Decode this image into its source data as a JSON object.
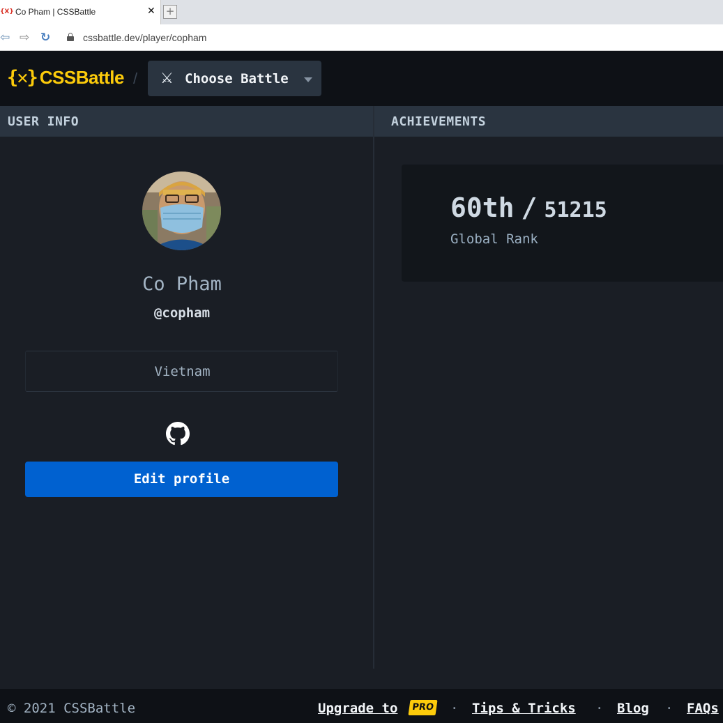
{
  "browser": {
    "tab_favicon": "{X}",
    "tab_title": "Co Pham | CSSBattle",
    "tab_close": "✕",
    "new_tab": "+",
    "nav_back": "⇦",
    "nav_forward": "⇨",
    "nav_reload": "↻",
    "url": "cssbattle.dev/player/copham"
  },
  "header": {
    "logo_mark": "{✕}",
    "logo_text": "CSSBattle",
    "separator": "/",
    "choose_battle_icon": "⚔",
    "choose_battle_label": "Choose Battle"
  },
  "user_info": {
    "section_title": "USER INFO",
    "name": "Co Pham",
    "handle": "@copham",
    "country": "Vietnam",
    "edit_button": "Edit profile"
  },
  "achievements": {
    "section_title": "ACHIEVEMENTS",
    "rank": "60th",
    "rank_separator": "/",
    "total_players": "51215",
    "rank_label": "Global Rank"
  },
  "footer": {
    "copyright": "© 2021 CSSBattle",
    "upgrade_label": "Upgrade to",
    "pro_badge": "PRO",
    "separator": "·",
    "tips_label": "Tips & Tricks",
    "blog_label": "Blog",
    "faqs_label": "FAQs"
  },
  "colors": {
    "accent": "#fccb0b",
    "primary_button": "#0061d0",
    "background": "#1a1e25",
    "panel_header": "#2a3440"
  },
  "icons": [
    "lock-icon",
    "swords-icon",
    "chevron-down-icon",
    "github-icon",
    "avatar"
  ]
}
